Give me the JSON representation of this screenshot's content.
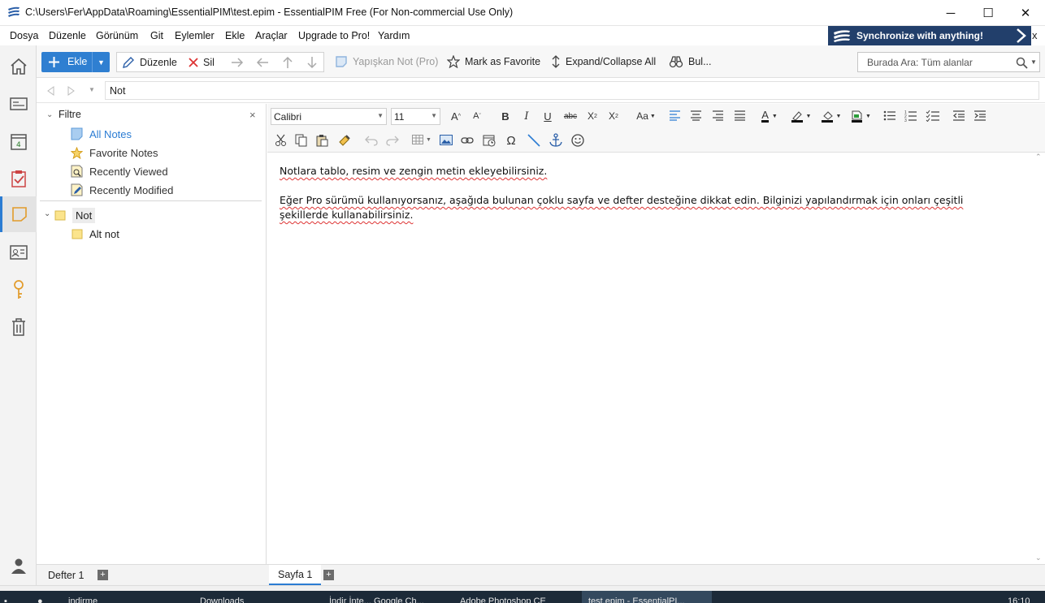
{
  "window": {
    "title": "C:\\Users\\Fer\\AppData\\Roaming\\EssentialPIM\\test.epim - EssentialPIM Free (For Non-commercial Use Only)",
    "minimize": "─",
    "maximize": "☐",
    "close": "✕"
  },
  "menu": {
    "items": [
      "Dosya",
      "Düzenle",
      "Görünüm",
      "Git",
      "Eylemler",
      "Ekle",
      "Araçlar",
      "Upgrade to Pro!",
      "Yardım"
    ],
    "sync_banner": "Synchronize with anything!",
    "sync_close": "x"
  },
  "toolbar": {
    "add": "Ekle",
    "edit": "Düzenle",
    "delete": "Sil",
    "sticky_note": "Yapışkan Not (Pro)",
    "favorite": "Mark as Favorite",
    "expand_collapse": "Expand/Collapse All",
    "find": "Bul...",
    "search_placeholder": "Burada Ara: Tüm alanlar"
  },
  "path": {
    "current": "Not"
  },
  "filter": {
    "title": "Filtre",
    "items": [
      "All Notes",
      "Favorite Notes",
      "Recently Viewed",
      "Recently Modified"
    ],
    "tree": [
      {
        "label": "Not",
        "expanded": true,
        "children": [
          "Alt not"
        ]
      }
    ]
  },
  "format": {
    "font": "Calibri",
    "size": "11"
  },
  "document": {
    "paragraph1": "Notlara tablo, resim ve zengin metin ekleyebilirsiniz.",
    "paragraph2": "Eğer Pro sürümü kullanıyorsanız, aşağıda bulunan çoklu sayfa ve defter desteğine dikkat edin. Bilginizi yapılandırmak için onları çeşitli şekillerde kullanabilirsiniz."
  },
  "tabs": {
    "notebook": "Defter 1",
    "page": "Sayfa 1"
  },
  "taskbar": {
    "items": [
      "indirme",
      "Downloads",
      "İndir İnte... Google Ch...",
      "Adobe Photoshop CE",
      "test.epim - EssentialPI..."
    ],
    "clock": "16:10"
  },
  "colors": {
    "accent": "#2f7fd1",
    "banner": "#223f6b",
    "link_selected": "#2b7cd3"
  }
}
